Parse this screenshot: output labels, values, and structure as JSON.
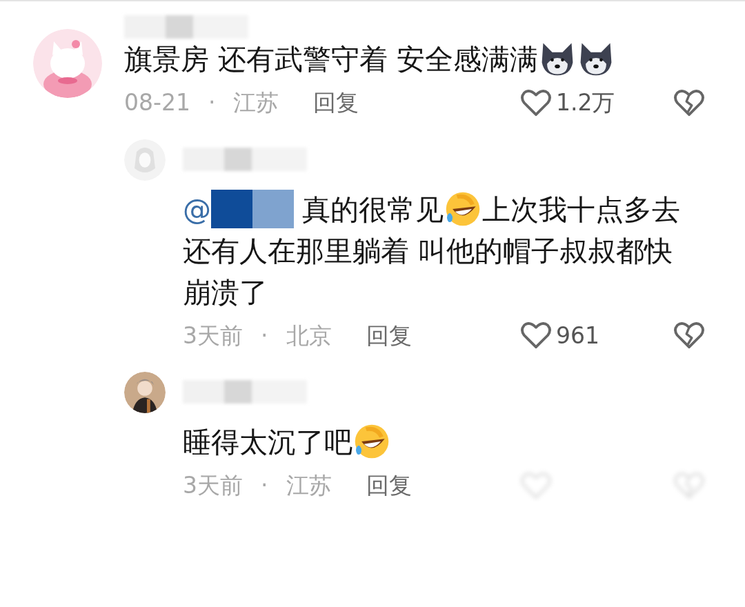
{
  "comments": [
    {
      "kind": "comment",
      "name_redacted": true,
      "parts": [
        {
          "kind": "text",
          "text": "旗景房 还有武警守着 安全感满满"
        },
        {
          "kind": "husky"
        },
        {
          "kind": "husky"
        }
      ],
      "date": "08-21",
      "separator": "·",
      "region": "江苏",
      "reply": "回复",
      "likes": "1.2万",
      "actions_blurred": false
    },
    {
      "kind": "reply",
      "name_redacted": true,
      "parts": [
        {
          "kind": "mention",
          "text": "@"
        },
        {
          "kind": "text",
          "text": "真的很常见"
        },
        {
          "kind": "laugh"
        },
        {
          "kind": "text",
          "text": "上次我十点多去还有人在那里躺着 叫他的帽子叔叔都快崩溃了"
        }
      ],
      "date": "3天前",
      "separator": "·",
      "region": "北京",
      "reply": "回复",
      "likes": "961",
      "actions_blurred": false
    },
    {
      "kind": "reply",
      "name_redacted": true,
      "parts": [
        {
          "kind": "text",
          "text": "睡得太沉了吧"
        },
        {
          "kind": "laugh"
        }
      ],
      "date": "3天前",
      "separator": "·",
      "region": "江苏",
      "reply": "回复",
      "actions_blurred": true
    }
  ]
}
